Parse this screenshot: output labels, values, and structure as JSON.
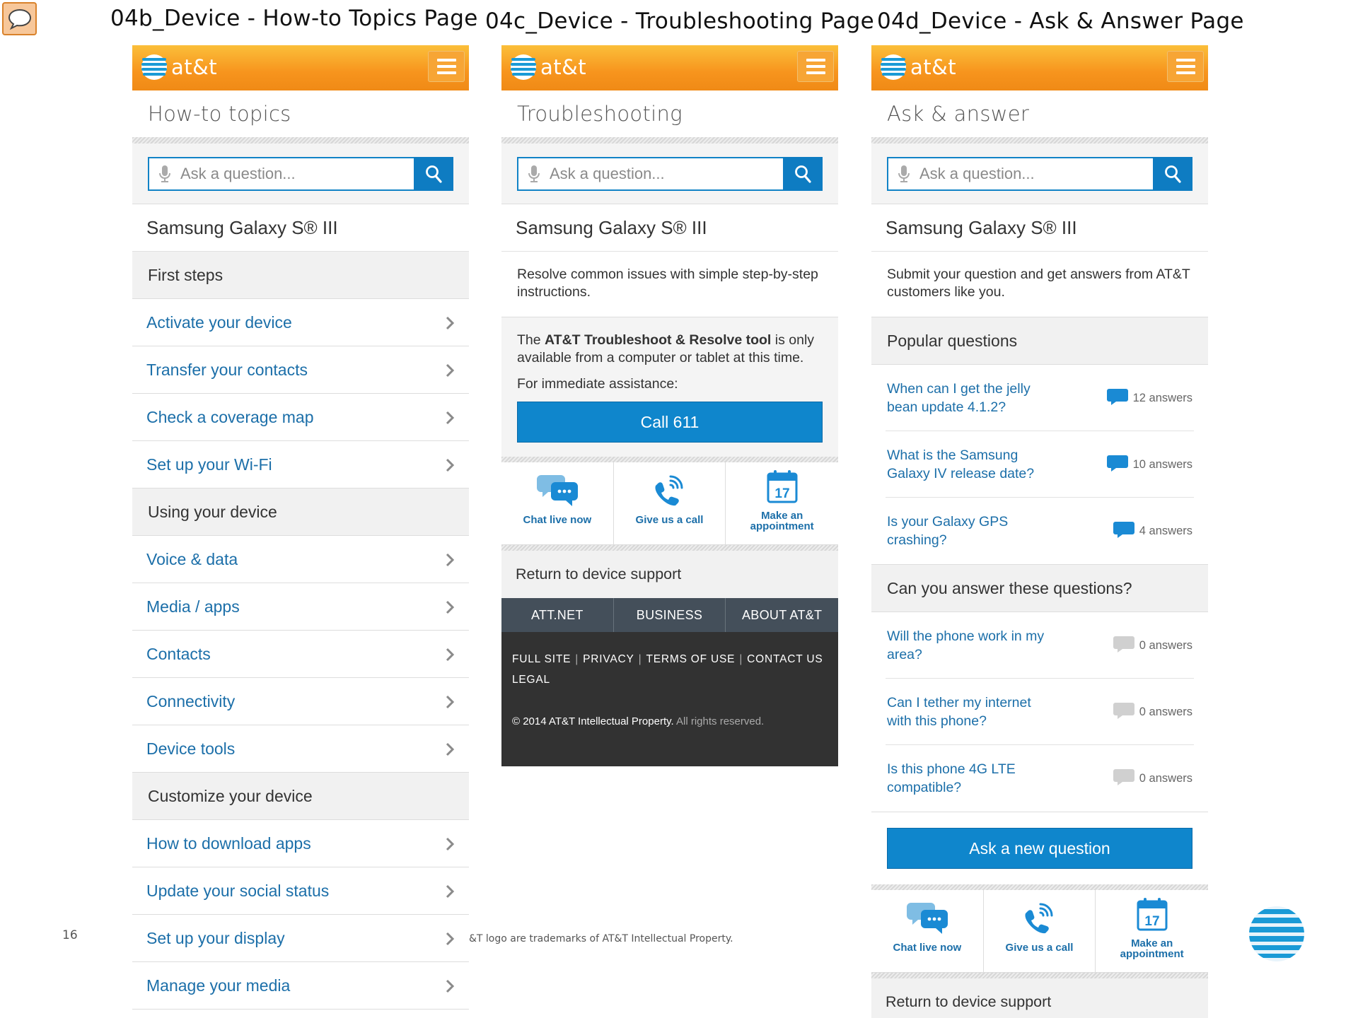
{
  "slide": {
    "titles": [
      "04b_Device - How-to Topics Page",
      "04c_Device - Troubleshooting Page",
      "04d_Device - Ask & Answer Page"
    ],
    "page_number": "16",
    "footer_note": "&T logo are trademarks of AT&T Intellectual Property."
  },
  "brand": {
    "logo_text": "at&t",
    "accent": "#f7941d",
    "link_color": "#1c6fa9",
    "button_color": "#0f86cc"
  },
  "search": {
    "placeholder": "Ask a question..."
  },
  "device_name": "Samsung Galaxy S® III",
  "howto": {
    "title": "How-to topics",
    "sections": [
      {
        "heading": "First steps",
        "items": [
          "Activate your device",
          "Transfer your contacts",
          "Check a coverage map",
          "Set up your Wi-Fi"
        ]
      },
      {
        "heading": "Using your device",
        "items": [
          "Voice & data",
          "Media / apps",
          "Contacts",
          "Connectivity",
          "Device tools"
        ]
      },
      {
        "heading": "Customize your device",
        "items": [
          "How to download apps",
          "Update your social status",
          "Set up your display",
          "Manage your media"
        ]
      }
    ]
  },
  "troubleshooting": {
    "title": "Troubleshooting",
    "description": "Resolve common issues with simple step-by-step instructions.",
    "tool_prefix": "The ",
    "tool_name": "AT&T Troubleshoot & Resolve tool",
    "tool_suffix": " is only available from a computer or tablet at this time.",
    "assistance": "For immediate assistance:",
    "call_button": "Call 611"
  },
  "contact_options": {
    "chat": "Chat live now",
    "call": "Give us a call",
    "appointment_1": "Make an",
    "appointment_2": "appointment",
    "calendar_day": "17"
  },
  "return_link": "Return to device support",
  "footer": {
    "tabs": [
      "ATT.NET",
      "BUSINESS",
      "ABOUT AT&T"
    ],
    "links": [
      "FULL SITE",
      "PRIVACY",
      "TERMS OF USE",
      "CONTACT US",
      "LEGAL"
    ],
    "copyright": "© 2014 AT&T Intellectual Property.",
    "rights": " All rights reserved."
  },
  "ask_answer": {
    "title": "Ask & answer",
    "description": "Submit your question and get answers from AT&T customers like you.",
    "popular_heading": "Popular questions",
    "popular": [
      {
        "question": "When can I get the jelly bean update 4.1.2?",
        "answers": "12 answers"
      },
      {
        "question": "What is the Samsung Galaxy IV release date?",
        "answers": "10 answers"
      },
      {
        "question": "Is your Galaxy GPS crashing?",
        "answers": "4 answers"
      }
    ],
    "unanswered_heading": "Can you answer these questions?",
    "unanswered": [
      {
        "question": "Will the phone work in my area?",
        "answers": "0 answers"
      },
      {
        "question": "Can I tether my internet with this phone?",
        "answers": "0 answers"
      },
      {
        "question": "Is this phone 4G LTE compatible?",
        "answers": "0 answers"
      }
    ],
    "ask_button": "Ask a new question"
  }
}
